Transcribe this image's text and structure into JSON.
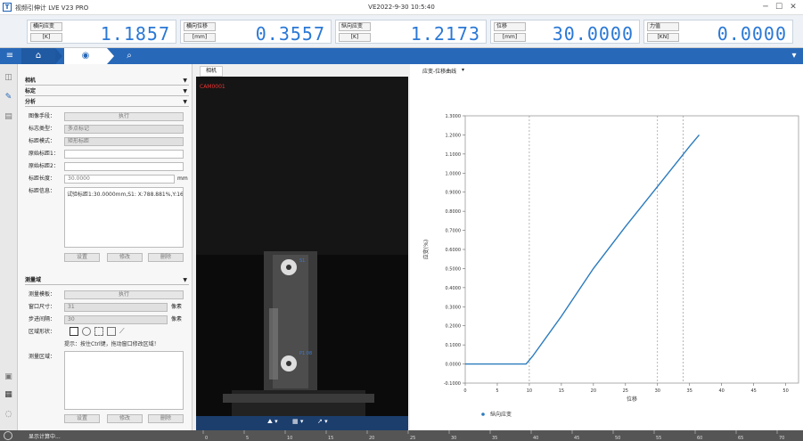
{
  "window": {
    "title": "视频引伸计 LVE V23 PRO",
    "datetime": "VE2022-9-30 10:5:40",
    "min": "─",
    "max": "☐",
    "close": "✕"
  },
  "readings": [
    {
      "label": "横向应变",
      "unit": "[K]",
      "value": "1.1857"
    },
    {
      "label": "横向位移",
      "unit": "[mm]",
      "value": "0.3557"
    },
    {
      "label": "纵向应变",
      "unit": "[K]",
      "value": "1.2173"
    },
    {
      "label": "位移",
      "unit": "[mm]",
      "value": "30.0000"
    },
    {
      "label": "力值",
      "unit": "[KN]",
      "value": "0.0000"
    }
  ],
  "toolbar": {
    "menu": "≡",
    "home": "⌂",
    "camera": "◉",
    "search": "⌕",
    "right": "▾"
  },
  "leftstrip": [
    "◫",
    "✎",
    "▤",
    "▣",
    "▦",
    "◌"
  ],
  "panel": {
    "sections": [
      {
        "label": "相机"
      },
      {
        "label": "标定"
      },
      {
        "label": "分析"
      }
    ],
    "analysis": {
      "f1_label": "图像手段：",
      "f1_value": "执行",
      "f2_label": "标志类型：",
      "f2_value": "多点标记",
      "f3_label": "标距模式：",
      "f3_value": "矩形标距",
      "f4_label": "原始标距1：",
      "f4_value": "",
      "f5_label": "原始标距2：",
      "f5_value": "",
      "f6_label": "标距长度：",
      "f6_value": "30.0000",
      "f6_unit": "mm",
      "f7_label": "标距信息：",
      "f7_value": "试验标距1:30.0000mm,S1: X:788.881%,Y:166",
      "btn1": "设置",
      "btn2": "修改",
      "btn3": "删除"
    },
    "measure": {
      "header": "测量域",
      "f1_label": "测量模板：",
      "f1_value": "执行",
      "f2_label": "窗口尺寸：",
      "f2_value": "31",
      "f2_unit": "像素",
      "f3_label": "步进间隔：",
      "f3_value": "30",
      "f3_unit": "像素",
      "f4_label": "区域形状：",
      "hint": "提示：按住Ctrl键，拖动窗口修改区域！",
      "f5_label": "测量区域：",
      "btn1": "设置",
      "btn2": "修改",
      "btn3": "删除"
    },
    "bottom_label": "显示计算中..."
  },
  "camera": {
    "tab": "相机",
    "overlay": "CAM0001",
    "mark1": "S1",
    "mark2": "P1 08",
    "tools": [
      "⛰ ▾",
      "▦ ▾",
      "↗ ▾"
    ]
  },
  "chart_title": "应变-位移曲线",
  "chart_data": {
    "type": "line",
    "title": "",
    "xlabel": "位移",
    "ylabel": "应变(%)",
    "xlim": [
      0,
      52
    ],
    "ylim": [
      -0.1,
      1.3
    ],
    "xticks": [
      0,
      5,
      10,
      15,
      20,
      25,
      30,
      35,
      40,
      45,
      50
    ],
    "yticks": [
      -0.1,
      0,
      0.1,
      0.2,
      0.3,
      0.4,
      0.5,
      0.6,
      0.7,
      0.8,
      0.9,
      1.0,
      1.1,
      1.2,
      1.3
    ],
    "ytick_labels": [
      "-0.1000",
      "0.0000",
      "0.1000",
      "0.2000",
      "0.3000",
      "0.4000",
      "0.5000",
      "0.6000",
      "0.7000",
      "0.8000",
      "0.9000",
      "1.0000",
      "1.1000",
      "1.2000",
      "1.3000"
    ],
    "vlines": [
      10,
      30,
      34
    ],
    "series": [
      {
        "name": "纵向应变",
        "color": "#2b7bbd",
        "x": [
          0,
          9.5,
          10.5,
          15,
          20,
          25,
          30,
          35,
          36.5
        ],
        "y": [
          0,
          0,
          0.04,
          0.25,
          0.5,
          0.72,
          0.93,
          1.14,
          1.2
        ]
      }
    ]
  },
  "bottom_ruler": [
    "0",
    "5",
    "10",
    "15",
    "20",
    "25",
    "30",
    "35",
    "40",
    "45",
    "50",
    "55",
    "60",
    "65",
    "70"
  ]
}
